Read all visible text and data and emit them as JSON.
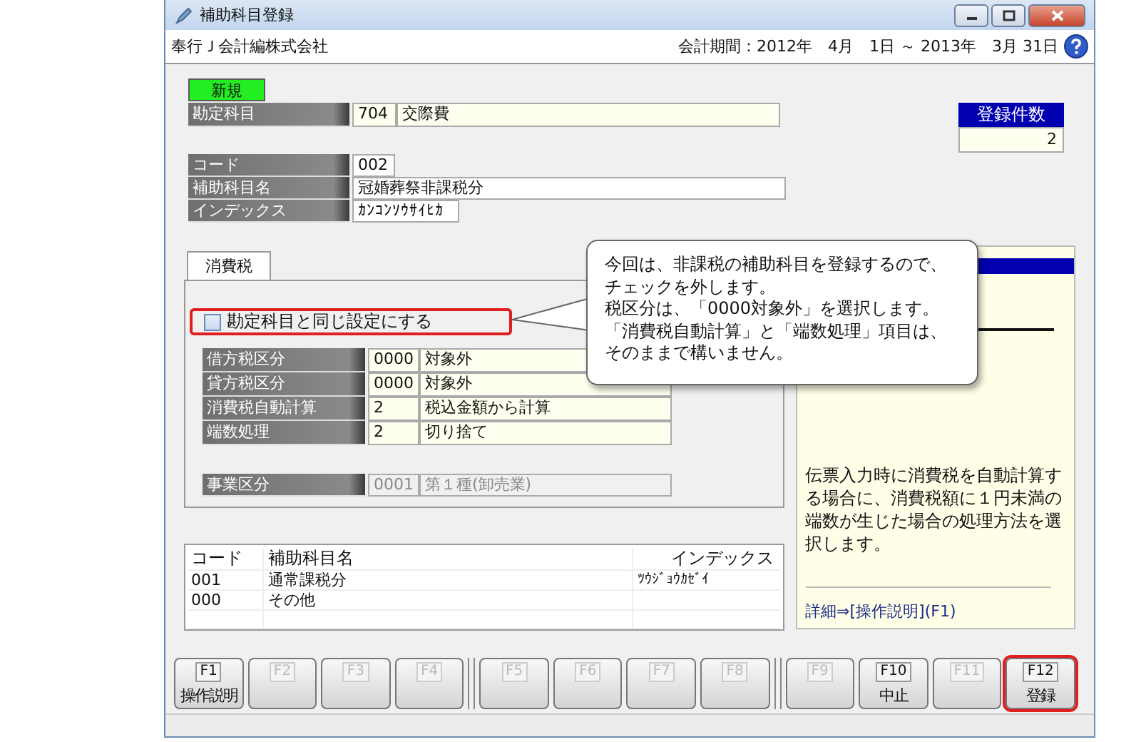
{
  "window": {
    "title": "補助科目登録"
  },
  "header": {
    "company": "奉行Ｊ会計編株式会社",
    "period": "会計期間：2012年　4月　1日 ～ 2013年　3月 31日"
  },
  "mode_badge": "新規",
  "account": {
    "label": "勘定科目",
    "code": "704",
    "name": "交際費"
  },
  "count": {
    "label": "登録件数",
    "value": "2"
  },
  "fields": [
    {
      "label": "コード",
      "value": "002",
      "kind": "short"
    },
    {
      "label": "補助科目名",
      "value": "冠婚葬祭非課税分",
      "kind": "long"
    },
    {
      "label": "インデックス",
      "value": "ｶﾝｺﾝｿｳｻｲﾋｶ",
      "kind": "medium"
    }
  ],
  "tabs": [
    {
      "label": "消費税",
      "selected": true
    }
  ],
  "same_setting": {
    "label": "勘定科目と同じ設定にする",
    "checked": false,
    "highlighted": true
  },
  "tax_rows": [
    {
      "label": "借方税区分",
      "code": "0000",
      "name": "対象外"
    },
    {
      "label": "貸方税区分",
      "code": "0000",
      "name": "対象外"
    },
    {
      "label": "消費税自動計算",
      "code": "2",
      "name": "税込金額から計算"
    },
    {
      "label": "端数処理",
      "code": "2",
      "name": "切り捨て"
    }
  ],
  "business_type": {
    "label": "事業区分",
    "code": "0001",
    "name": "第１種(卸売業)",
    "disabled": true
  },
  "list": {
    "columns": [
      "コード",
      "補助科目名",
      "インデックス"
    ],
    "rows": [
      {
        "code": "001",
        "name": "通常課税分",
        "index": "ﾂｳｼﾞｮｳｶｾﾞｲ"
      },
      {
        "code": "000",
        "name": "その他"
      }
    ]
  },
  "info_panel": {
    "description": "伝票入力時に消費税を自動計算する場合に、消費税額に１円未満の端数が生じた場合の処理方法を選択します。",
    "link": "詳細⇒[操作説明](F1)"
  },
  "function_keys": [
    {
      "key": "F1",
      "label": "操作説明",
      "disabled": false,
      "highlighted": false
    },
    {
      "key": "F2",
      "disabled": true,
      "highlighted": false
    },
    {
      "key": "F3",
      "disabled": true,
      "highlighted": false
    },
    {
      "key": "F4",
      "disabled": true,
      "highlighted": false
    },
    {
      "key": "F5",
      "disabled": true,
      "highlighted": false
    },
    {
      "key": "F6",
      "disabled": true,
      "highlighted": false
    },
    {
      "key": "F7",
      "disabled": true,
      "highlighted": false
    },
    {
      "key": "F8",
      "disabled": true,
      "highlighted": false
    },
    {
      "key": "F9",
      "disabled": true,
      "highlighted": false
    },
    {
      "key": "F10",
      "label": "中止",
      "disabled": false,
      "highlighted": false
    },
    {
      "key": "F11",
      "disabled": true,
      "highlighted": false
    },
    {
      "key": "F12",
      "label": "登録",
      "disabled": false,
      "highlighted": true
    }
  ],
  "callout": {
    "lines": [
      "今回は、非課税の補助科目を登録するので、",
      "チェックを外します。",
      "税区分は、「0000対象外」を選択します。",
      "「消費税自動計算」と「端数処理」項目は、",
      "そのままで構いません。"
    ]
  }
}
